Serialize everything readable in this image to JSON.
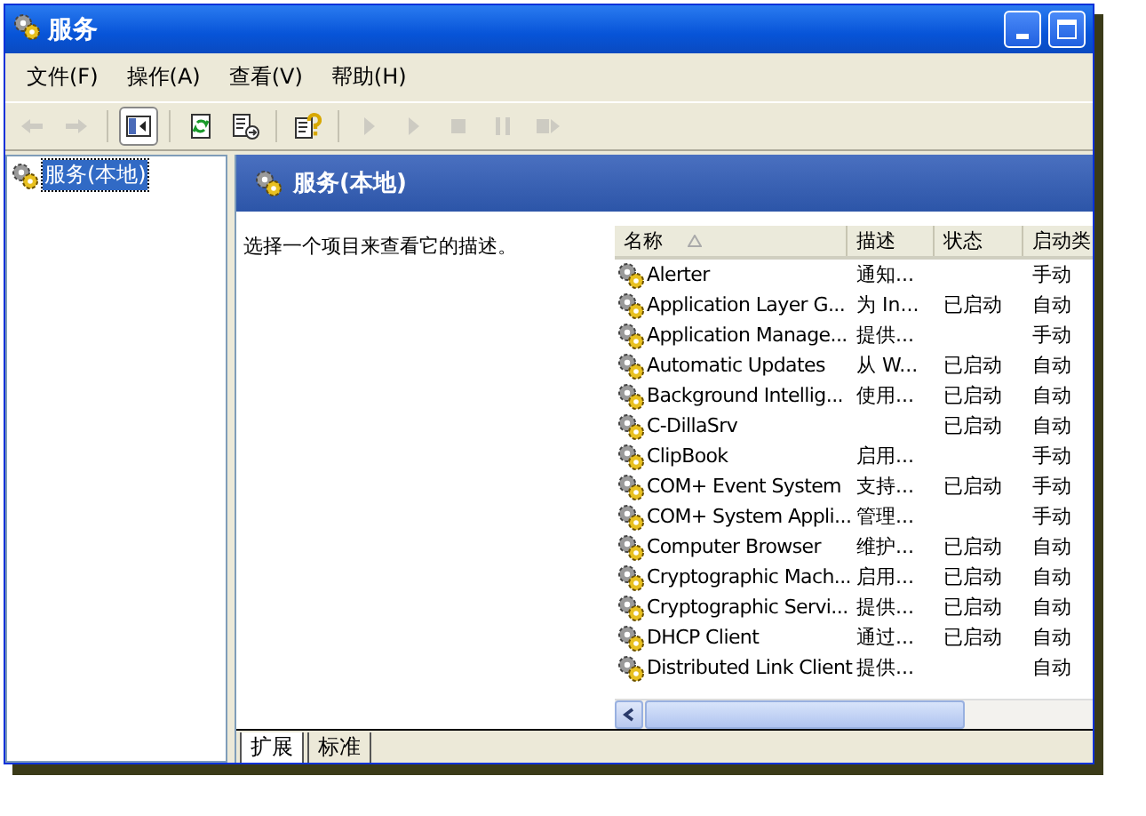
{
  "window": {
    "title": "服务"
  },
  "menu": [
    {
      "label": "文件(F)"
    },
    {
      "label": "操作(A)"
    },
    {
      "label": "查看(V)"
    },
    {
      "label": "帮助(H)"
    }
  ],
  "toolbar": [
    {
      "kind": "back",
      "disabled": true
    },
    {
      "kind": "forward",
      "disabled": true
    },
    {
      "kind": "sep"
    },
    {
      "kind": "tree",
      "disabled": false,
      "selected": true
    },
    {
      "kind": "sep"
    },
    {
      "kind": "refresh",
      "disabled": false
    },
    {
      "kind": "export",
      "disabled": false
    },
    {
      "kind": "sep"
    },
    {
      "kind": "help",
      "disabled": false
    },
    {
      "kind": "sep"
    },
    {
      "kind": "play",
      "disabled": true
    },
    {
      "kind": "play",
      "disabled": true
    },
    {
      "kind": "stop",
      "disabled": true
    },
    {
      "kind": "pause",
      "disabled": true
    },
    {
      "kind": "restart",
      "disabled": true
    }
  ],
  "tree": [
    {
      "label": "服务(本地)",
      "selected": true
    }
  ],
  "pane": {
    "title": "服务(本地)",
    "description": "选择一个项目来查看它的描述。"
  },
  "table": {
    "columns": [
      {
        "label": "名称",
        "sorted": true
      },
      {
        "label": "描述",
        "sorted": false
      },
      {
        "label": "状态",
        "sorted": false
      },
      {
        "label": "启动类",
        "sorted": false
      }
    ],
    "rows": [
      {
        "name": "Alerter",
        "description": "通知...",
        "status": "",
        "startup": "手动"
      },
      {
        "name": "Application Layer G...",
        "description": "为 In...",
        "status": "已启动",
        "startup": "自动"
      },
      {
        "name": "Application Manage...",
        "description": "提供...",
        "status": "",
        "startup": "手动"
      },
      {
        "name": "Automatic Updates",
        "description": "从 W...",
        "status": "已启动",
        "startup": "自动"
      },
      {
        "name": "Background Intellig...",
        "description": "使用...",
        "status": "已启动",
        "startup": "自动"
      },
      {
        "name": "C-DillaSrv",
        "description": "",
        "status": "已启动",
        "startup": "自动"
      },
      {
        "name": "ClipBook",
        "description": "启用...",
        "status": "",
        "startup": "手动"
      },
      {
        "name": "COM+ Event System",
        "description": "支持...",
        "status": "已启动",
        "startup": "手动"
      },
      {
        "name": "COM+ System Appli...",
        "description": "管理...",
        "status": "",
        "startup": "手动"
      },
      {
        "name": "Computer Browser",
        "description": "维护...",
        "status": "已启动",
        "startup": "自动"
      },
      {
        "name": "Cryptographic Mach...",
        "description": "启用...",
        "status": "已启动",
        "startup": "自动"
      },
      {
        "name": "Cryptographic Servi...",
        "description": "提供...",
        "status": "已启动",
        "startup": "自动"
      },
      {
        "name": "DHCP Client",
        "description": "通过...",
        "status": "已启动",
        "startup": "自动"
      },
      {
        "name": "Distributed Link Client",
        "description": "提供...",
        "status": "",
        "startup": "自动"
      }
    ]
  },
  "tabs": [
    {
      "label": "扩展",
      "selected": true
    },
    {
      "label": "标准",
      "selected": false
    }
  ]
}
